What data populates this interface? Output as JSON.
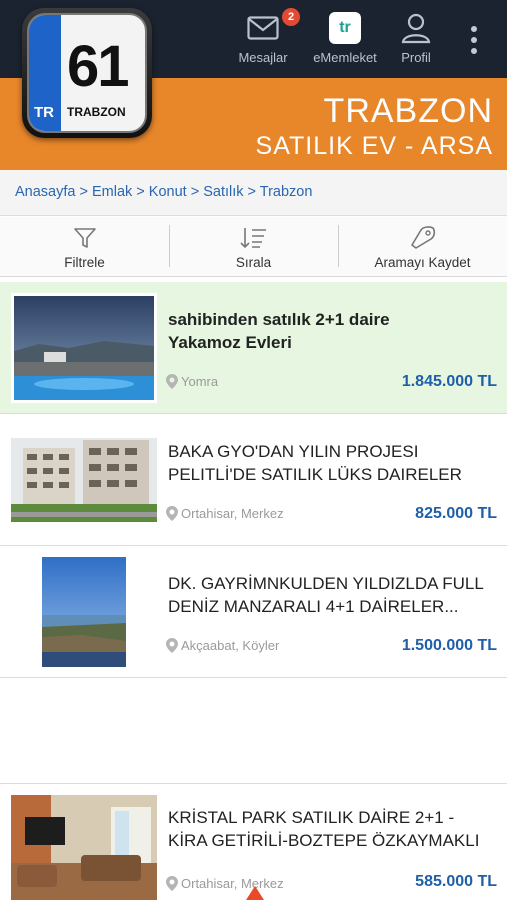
{
  "header": {
    "logo_number": "61",
    "logo_country": "TR",
    "logo_city": "TRABZON",
    "messages_label": "Mesajlar",
    "messages_badge": "2",
    "ememleket_label": "eMemleket",
    "ememleket_glyph": "tr",
    "profile_label": "Profil",
    "city_title": "TRABZON",
    "city_subtitle": "SATILIK EV - ARSA",
    "accent_color": "#e8862a"
  },
  "breadcrumb": "Anasayfa > Emlak > Konut > Satılık > Trabzon",
  "toolbar": {
    "filter_label": "Filtrele",
    "sort_label": "Sırala",
    "save_search_label": "Aramayı Kaydet"
  },
  "listings": [
    {
      "title_line1": "sahibinden satılık 2+1 daire",
      "title_line2": "Yakamoz Evleri",
      "location": "Yomra",
      "price": "1.845.000 TL",
      "highlighted": true
    },
    {
      "title_line1": "BAKA GYO'DAN YILIN PROJESI",
      "title_line2": "PELITLİ'DE SATILIK LÜKS DAIRELER",
      "location": "Ortahisar,  Merkez",
      "price": "825.000 TL",
      "highlighted": false
    },
    {
      "title_line1": "DK. GAYRİMNKULDEN YILDIZLDA FULL",
      "title_line2": "DENİZ MANZARALI 4+1 DAİRELER...",
      "location": "Akçaabat,  Köyler",
      "price": "1.500.000 TL",
      "highlighted": false
    },
    {
      "title_line1": "KRİSTAL PARK SATILIK DAİRE 2+1 -",
      "title_line2": "KİRA GETİRİLİ-BOZTEPE ÖZKAYMAKLI",
      "location": "Ortahisar,  Merkez",
      "price": "585.000 TL",
      "highlighted": false
    }
  ]
}
